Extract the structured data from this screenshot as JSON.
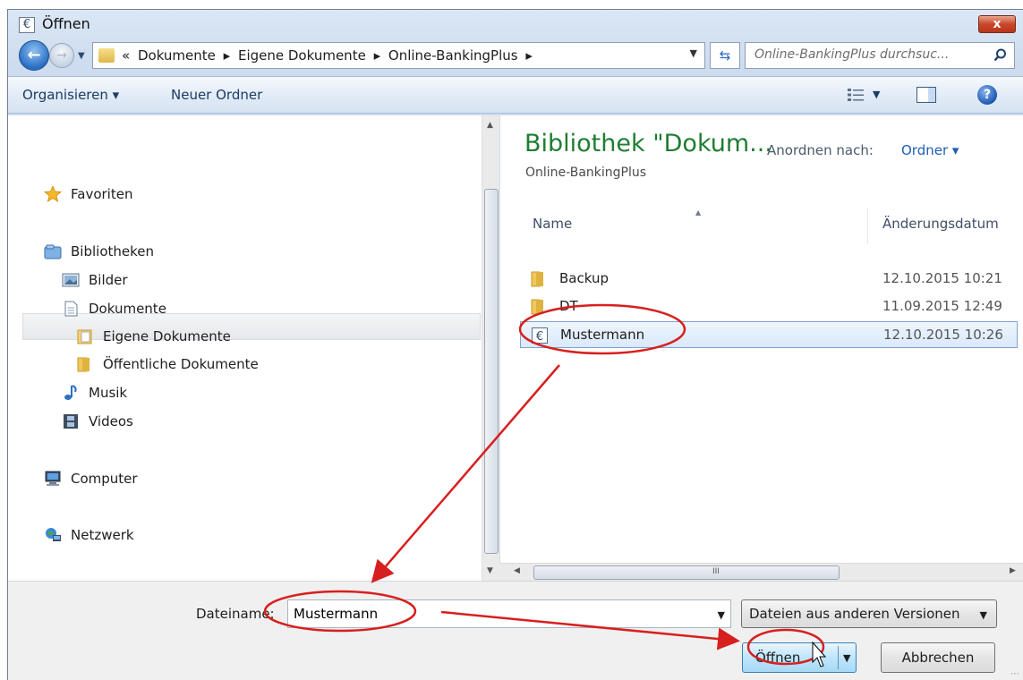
{
  "window": {
    "title": "Öffnen",
    "close_label": "x"
  },
  "address": {
    "crumbs": [
      "«",
      "Dokumente",
      "▸",
      "Eigene Dokumente",
      "▸",
      "Online-BankingPlus",
      "▸"
    ],
    "search_placeholder": "Online-BankingPlus durchsuc..."
  },
  "toolbar": {
    "organize": "Organisieren ▾",
    "new_folder": "Neuer Ordner"
  },
  "nav": {
    "favorites": "Favoriten",
    "libraries": "Bibliotheken",
    "pictures": "Bilder",
    "documents": "Dokumente",
    "my_documents": "Eigene Dokumente",
    "public_documents": "Öffentliche Dokumente",
    "music": "Musik",
    "videos": "Videos",
    "computer": "Computer",
    "network": "Netzwerk"
  },
  "content": {
    "library_title": "Bibliothek \"Dokum...",
    "library_subtitle": "Online-BankingPlus",
    "arrange_label": "Anordnen nach:",
    "arrange_value": "Ordner ▾",
    "col_name": "Name",
    "col_date": "Änderungsdatum",
    "files": [
      {
        "name": "Backup",
        "date": "12.10.2015 10:21",
        "icon": "folder-icon"
      },
      {
        "name": "DT",
        "date": "11.09.2015 12:49",
        "icon": "folder-icon"
      },
      {
        "name": "Mustermann",
        "date": "12.10.2015 10:26",
        "icon": "euro-file-icon",
        "selected": true
      }
    ],
    "hscroll_grip": "III"
  },
  "bottom": {
    "filename_label": "Dateiname:",
    "filename_value": "Mustermann",
    "filter_label": "Dateien aus anderen Versionen",
    "open_label": "Öffnen",
    "cancel_label": "Abbrechen"
  },
  "colors": {
    "library_title": "#1e7d32",
    "annotation": "#d81f1f",
    "accent": "#1e5fb5"
  }
}
